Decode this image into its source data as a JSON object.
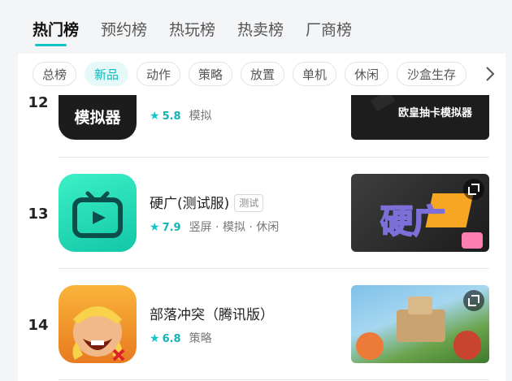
{
  "tabs": [
    {
      "label": "热门榜",
      "active": true
    },
    {
      "label": "预约榜",
      "active": false
    },
    {
      "label": "热玩榜",
      "active": false
    },
    {
      "label": "热卖榜",
      "active": false
    },
    {
      "label": "厂商榜",
      "active": false
    }
  ],
  "chips": [
    {
      "label": "总榜",
      "active": false
    },
    {
      "label": "新品",
      "active": true
    },
    {
      "label": "动作",
      "active": false
    },
    {
      "label": "策略",
      "active": false
    },
    {
      "label": "放置",
      "active": false
    },
    {
      "label": "单机",
      "active": false
    },
    {
      "label": "休闲",
      "active": false
    },
    {
      "label": "沙盒生存",
      "active": false
    }
  ],
  "games": [
    {
      "rank": "12",
      "icon_text": "模拟器",
      "rating": "5.8",
      "tags": "模拟",
      "screenshot_text": "欧皇抽卡模拟器"
    },
    {
      "rank": "13",
      "title": "硬广(测试服)",
      "badge": "测试",
      "rating": "7.9",
      "tags": "竖屏 · 模拟 · 休闲",
      "screenshot_text": "硬广"
    },
    {
      "rank": "14",
      "title": "部落冲突（腾讯版）",
      "rating": "6.8",
      "tags": "策略"
    }
  ],
  "colors": {
    "accent": "#14c5c5",
    "panel": "#ffffff",
    "page_bg": "#f4f5f7"
  },
  "icons": {
    "chips_next": "chevron-right-icon",
    "rating": "star-icon",
    "screenshot": "expand-icon"
  }
}
